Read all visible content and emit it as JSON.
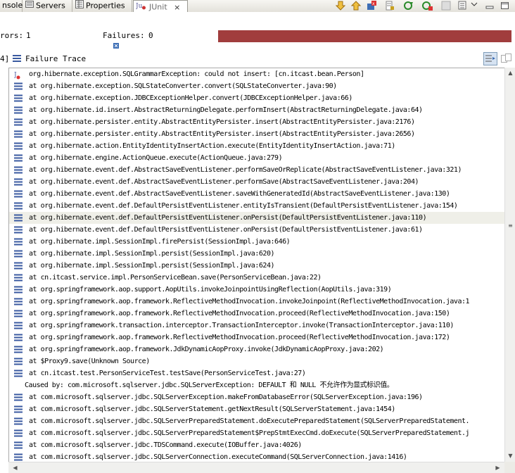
{
  "tabs": [
    {
      "label": "nsole"
    },
    {
      "label": "Servers"
    },
    {
      "label": "Properties"
    },
    {
      "label": "JUnit"
    }
  ],
  "tab_close_glyph": "×",
  "stats": {
    "errors_label": "rors:",
    "errors_value": "1",
    "failures_label": "Failures:",
    "failures_value": "0",
    "bar_color": "#a13d3d",
    "bar_fill_fraction": 1.0
  },
  "failure_trace": {
    "prefix": "4]",
    "label": "Failure Trace"
  },
  "trace": [
    {
      "icon": "junit-failure-icon",
      "text": "org.hibernate.exception.SQLGrammarException: could not insert: [cn.itcast.bean.Person]"
    },
    {
      "icon": "stack-frame-icon",
      "text": "at org.hibernate.exception.SQLStateConverter.convert(SQLStateConverter.java:90)"
    },
    {
      "icon": "stack-frame-icon",
      "text": "at org.hibernate.exception.JDBCExceptionHelper.convert(JDBCExceptionHelper.java:66)"
    },
    {
      "icon": "stack-frame-icon",
      "text": "at org.hibernate.id.insert.AbstractReturningDelegate.performInsert(AbstractReturningDelegate.java:64)"
    },
    {
      "icon": "stack-frame-icon",
      "text": "at org.hibernate.persister.entity.AbstractEntityPersister.insert(AbstractEntityPersister.java:2176)"
    },
    {
      "icon": "stack-frame-icon",
      "text": "at org.hibernate.persister.entity.AbstractEntityPersister.insert(AbstractEntityPersister.java:2656)"
    },
    {
      "icon": "stack-frame-icon",
      "text": "at org.hibernate.action.EntityIdentityInsertAction.execute(EntityIdentityInsertAction.java:71)"
    },
    {
      "icon": "stack-frame-icon",
      "text": "at org.hibernate.engine.ActionQueue.execute(ActionQueue.java:279)"
    },
    {
      "icon": "stack-frame-icon",
      "text": "at org.hibernate.event.def.AbstractSaveEventListener.performSaveOrReplicate(AbstractSaveEventListener.java:321)"
    },
    {
      "icon": "stack-frame-icon",
      "text": "at org.hibernate.event.def.AbstractSaveEventListener.performSave(AbstractSaveEventListener.java:204)"
    },
    {
      "icon": "stack-frame-icon",
      "text": "at org.hibernate.event.def.AbstractSaveEventListener.saveWithGeneratedId(AbstractSaveEventListener.java:130)"
    },
    {
      "icon": "stack-frame-icon",
      "text": "at org.hibernate.event.def.DefaultPersistEventListener.entityIsTransient(DefaultPersistEventListener.java:154)"
    },
    {
      "icon": "stack-frame-icon",
      "text": "at org.hibernate.event.def.DefaultPersistEventListener.onPersist(DefaultPersistEventListener.java:110)",
      "selected": true
    },
    {
      "icon": "stack-frame-icon",
      "text": "at org.hibernate.event.def.DefaultPersistEventListener.onPersist(DefaultPersistEventListener.java:61)"
    },
    {
      "icon": "stack-frame-icon",
      "text": "at org.hibernate.impl.SessionImpl.firePersist(SessionImpl.java:646)"
    },
    {
      "icon": "stack-frame-icon",
      "text": "at org.hibernate.impl.SessionImpl.persist(SessionImpl.java:620)"
    },
    {
      "icon": "stack-frame-icon",
      "text": "at org.hibernate.impl.SessionImpl.persist(SessionImpl.java:624)"
    },
    {
      "icon": "stack-frame-icon",
      "text": "at cn.itcast.service.impl.PersonServiceBean.save(PersonServiceBean.java:22)"
    },
    {
      "icon": "stack-frame-icon",
      "text": "at org.springframework.aop.support.AopUtils.invokeJoinpointUsingReflection(AopUtils.java:319)"
    },
    {
      "icon": "stack-frame-icon",
      "text": "at org.springframework.aop.framework.ReflectiveMethodInvocation.invokeJoinpoint(ReflectiveMethodInvocation.java:1"
    },
    {
      "icon": "stack-frame-icon",
      "text": "at org.springframework.aop.framework.ReflectiveMethodInvocation.proceed(ReflectiveMethodInvocation.java:150)"
    },
    {
      "icon": "stack-frame-icon",
      "text": "at org.springframework.transaction.interceptor.TransactionInterceptor.invoke(TransactionInterceptor.java:110)"
    },
    {
      "icon": "stack-frame-icon",
      "text": "at org.springframework.aop.framework.ReflectiveMethodInvocation.proceed(ReflectiveMethodInvocation.java:172)"
    },
    {
      "icon": "stack-frame-icon",
      "text": "at org.springframework.aop.framework.JdkDynamicAopProxy.invoke(JdkDynamicAopProxy.java:202)"
    },
    {
      "icon": "stack-frame-icon",
      "text": "at $Proxy9.save(Unknown Source)"
    },
    {
      "icon": "stack-frame-icon",
      "text": "at cn.itcast.test.PersonServiceTest.testSave(PersonServiceTest.java:27)"
    },
    {
      "icon": "",
      "text": "Caused by: com.microsoft.sqlserver.jdbc.SQLServerException: DEFAULT 和 NULL 不允许作为显式标识值。",
      "cause": true
    },
    {
      "icon": "stack-frame-icon",
      "text": "at com.microsoft.sqlserver.jdbc.SQLServerException.makeFromDatabaseError(SQLServerException.java:196)"
    },
    {
      "icon": "stack-frame-icon",
      "text": "at com.microsoft.sqlserver.jdbc.SQLServerStatement.getNextResult(SQLServerStatement.java:1454)"
    },
    {
      "icon": "stack-frame-icon",
      "text": "at com.microsoft.sqlserver.jdbc.SQLServerPreparedStatement.doExecutePreparedStatement(SQLServerPreparedStatement."
    },
    {
      "icon": "stack-frame-icon",
      "text": "at com.microsoft.sqlserver.jdbc.SQLServerPreparedStatement$PrepStmtExecCmd.doExecute(SQLServerPreparedStatement.j"
    },
    {
      "icon": "stack-frame-icon",
      "text": "at com.microsoft.sqlserver.jdbc.TDSCommand.execute(IOBuffer.java:4026)"
    },
    {
      "icon": "stack-frame-icon",
      "text": "at com.microsoft.sqlserver.jdbc.SQLServerConnection.executeCommand(SQLServerConnection.java:1416)"
    }
  ]
}
